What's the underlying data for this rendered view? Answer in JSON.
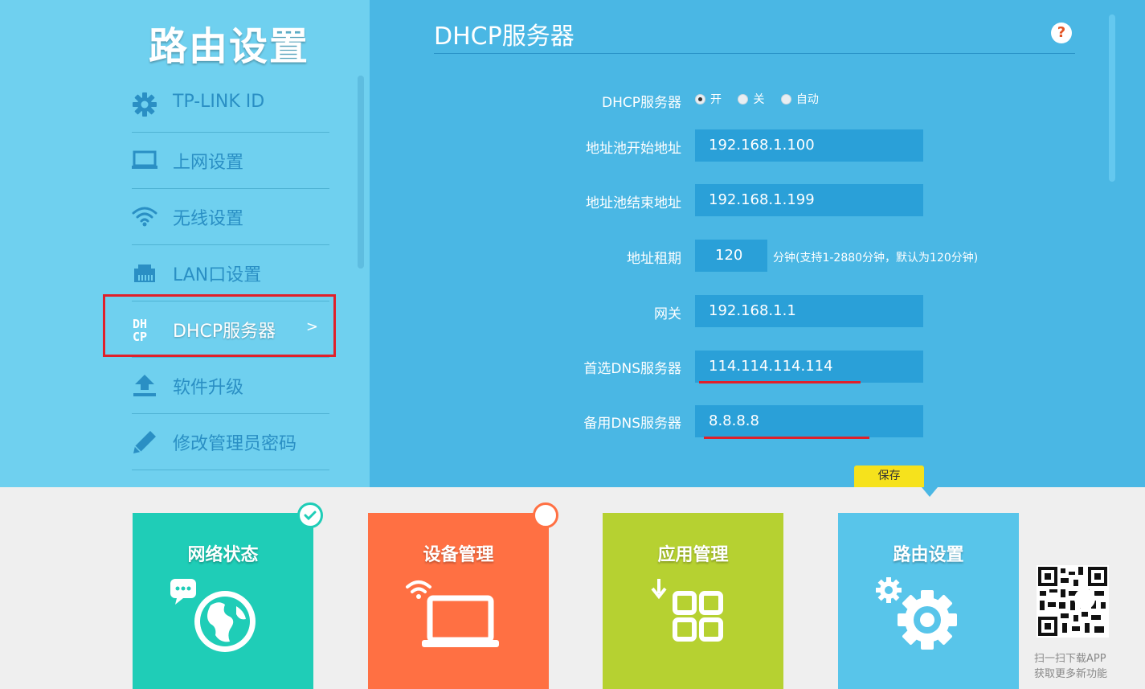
{
  "sidebar": {
    "title": "路由设置",
    "items": [
      {
        "label": "TP-LINK ID",
        "icon": "gear-icon"
      },
      {
        "label": "上网设置",
        "icon": "laptop-icon"
      },
      {
        "label": "无线设置",
        "icon": "wifi-icon"
      },
      {
        "label": "LAN口设置",
        "icon": "lan-port-icon"
      },
      {
        "label": "DHCP服务器",
        "icon": "dhcp-icon",
        "active": true,
        "chevron": ">"
      },
      {
        "label": "软件升级",
        "icon": "upload-icon"
      },
      {
        "label": "修改管理员密码",
        "icon": "pencil-icon"
      }
    ]
  },
  "main": {
    "title": "DHCP服务器",
    "help": "?",
    "form": {
      "dhcp_label": "DHCP服务器",
      "radio_options": [
        "开",
        "关",
        "自动"
      ],
      "radio_selected": "开",
      "pool_start_label": "地址池开始地址",
      "pool_start_value": "192.168.1.100",
      "pool_end_label": "地址池结束地址",
      "pool_end_value": "192.168.1.199",
      "lease_label": "地址租期",
      "lease_value": "120",
      "lease_hint": "分钟(支持1-2880分钟，默认为120分钟)",
      "gateway_label": "网关",
      "gateway_value": "192.168.1.1",
      "dns1_label": "首选DNS服务器",
      "dns1_value": "114.114.114.114",
      "dns2_label": "备用DNS服务器",
      "dns2_value": "8.8.8.8"
    },
    "save_label": "保存"
  },
  "tiles": [
    {
      "label": "网络状态",
      "color": "#1fcdb7",
      "icon": "globe-icon"
    },
    {
      "label": "设备管理",
      "color": "#ff7043",
      "icon": "laptop-wifi-icon"
    },
    {
      "label": "应用管理",
      "color": "#b6d131",
      "icon": "apps-grid-icon"
    },
    {
      "label": "路由设置",
      "color": "#58c5ea",
      "icon": "gears-icon"
    }
  ],
  "qr": {
    "line1": "扫一扫下载APP",
    "line2": "获取更多新功能"
  }
}
